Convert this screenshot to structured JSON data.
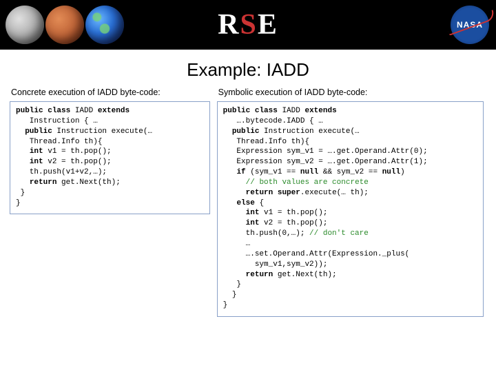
{
  "banner": {
    "planets": [
      "moon",
      "mars",
      "earth"
    ],
    "logo_left": "R",
    "logo_mid": "S",
    "logo_right": "E",
    "nasa_label": "NASA"
  },
  "title": "Example: IADD",
  "left": {
    "heading": "Concrete execution of IADD byte-code:",
    "code": "public class IADD extends\n   Instruction { …\n  public Instruction execute(…\n   Thread.Info th){\n   int v1 = th.pop();\n   int v2 = th.pop();\n   th.push(v1+v2,…);\n   return get.Next(th);\n }\n}"
  },
  "right": {
    "heading": "Symbolic execution of IADD byte-code:",
    "code": "public class IADD extends\n   ….bytecode.IADD { …\n  public Instruction execute(…\n   Thread.Info th){\n   Expression sym_v1 = ….get.Operand.Attr(0);\n   Expression sym_v2 = ….get.Operand.Attr(1);\n   if (sym_v1 == null && sym_v2 == null)\n     // both values are concrete\n     return super.execute(… th);\n   else {\n     int v1 = th.pop();\n     int v2 = th.pop();\n     th.push(0,…); // don't care\n     …\n     ….set.Operand.Attr(Expression._plus(\n       sym_v1,sym_v2));\n     return get.Next(th);\n   }\n  }\n}"
  }
}
